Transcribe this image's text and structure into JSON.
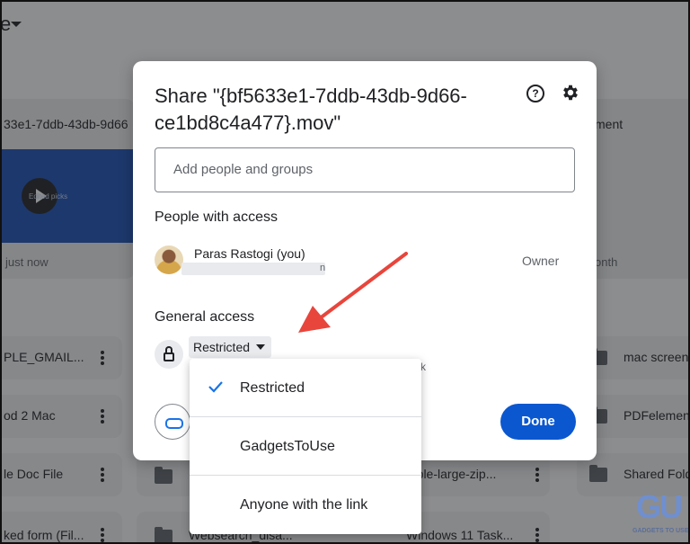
{
  "background": {
    "title_fragment": "e",
    "top_card_name": "33e1-7ddb-43db-9d66",
    "top_card_right_name": "ment",
    "thumb_text": "Edited picks",
    "top_card_meta": "just now",
    "top_card_right_meta": "onth",
    "rows": [
      {
        "left": "PLE_GMAIL...",
        "right": "mac screen"
      },
      {
        "left": "od 2 Mac",
        "right": "PDFelement"
      },
      {
        "left": "le Doc File",
        "mid": "mple-large-zip...",
        "right": "Shared Fold"
      },
      {
        "left": "ked form (Fil...",
        "mid": "Websearch_disa...",
        "mid2": "Windows 11 Task..."
      }
    ]
  },
  "dialog": {
    "title": "Share \"{bf5633e1-7ddb-43db-9d66-ce1bd8c4a477}.mov\"",
    "add_placeholder": "Add people and groups",
    "people_header": "People with access",
    "person_name": "Paras Rastogi (you)",
    "person_email_tail": "n",
    "person_role": "Owner",
    "general_header": "General access",
    "access_value": "Restricted",
    "hidden_text": "k",
    "done_label": "Done"
  },
  "access_menu": {
    "options": [
      {
        "label": "Restricted",
        "selected": true
      },
      {
        "label": "GadgetsToUse",
        "selected": false
      },
      {
        "label": "Anyone with the link",
        "selected": false
      }
    ]
  },
  "watermark": {
    "logo": "GU",
    "text": "GADGETS TO USE"
  },
  "colors": {
    "primary": "#0b57d0",
    "check": "#1a73e8",
    "annotation_arrow": "#e8453c"
  }
}
